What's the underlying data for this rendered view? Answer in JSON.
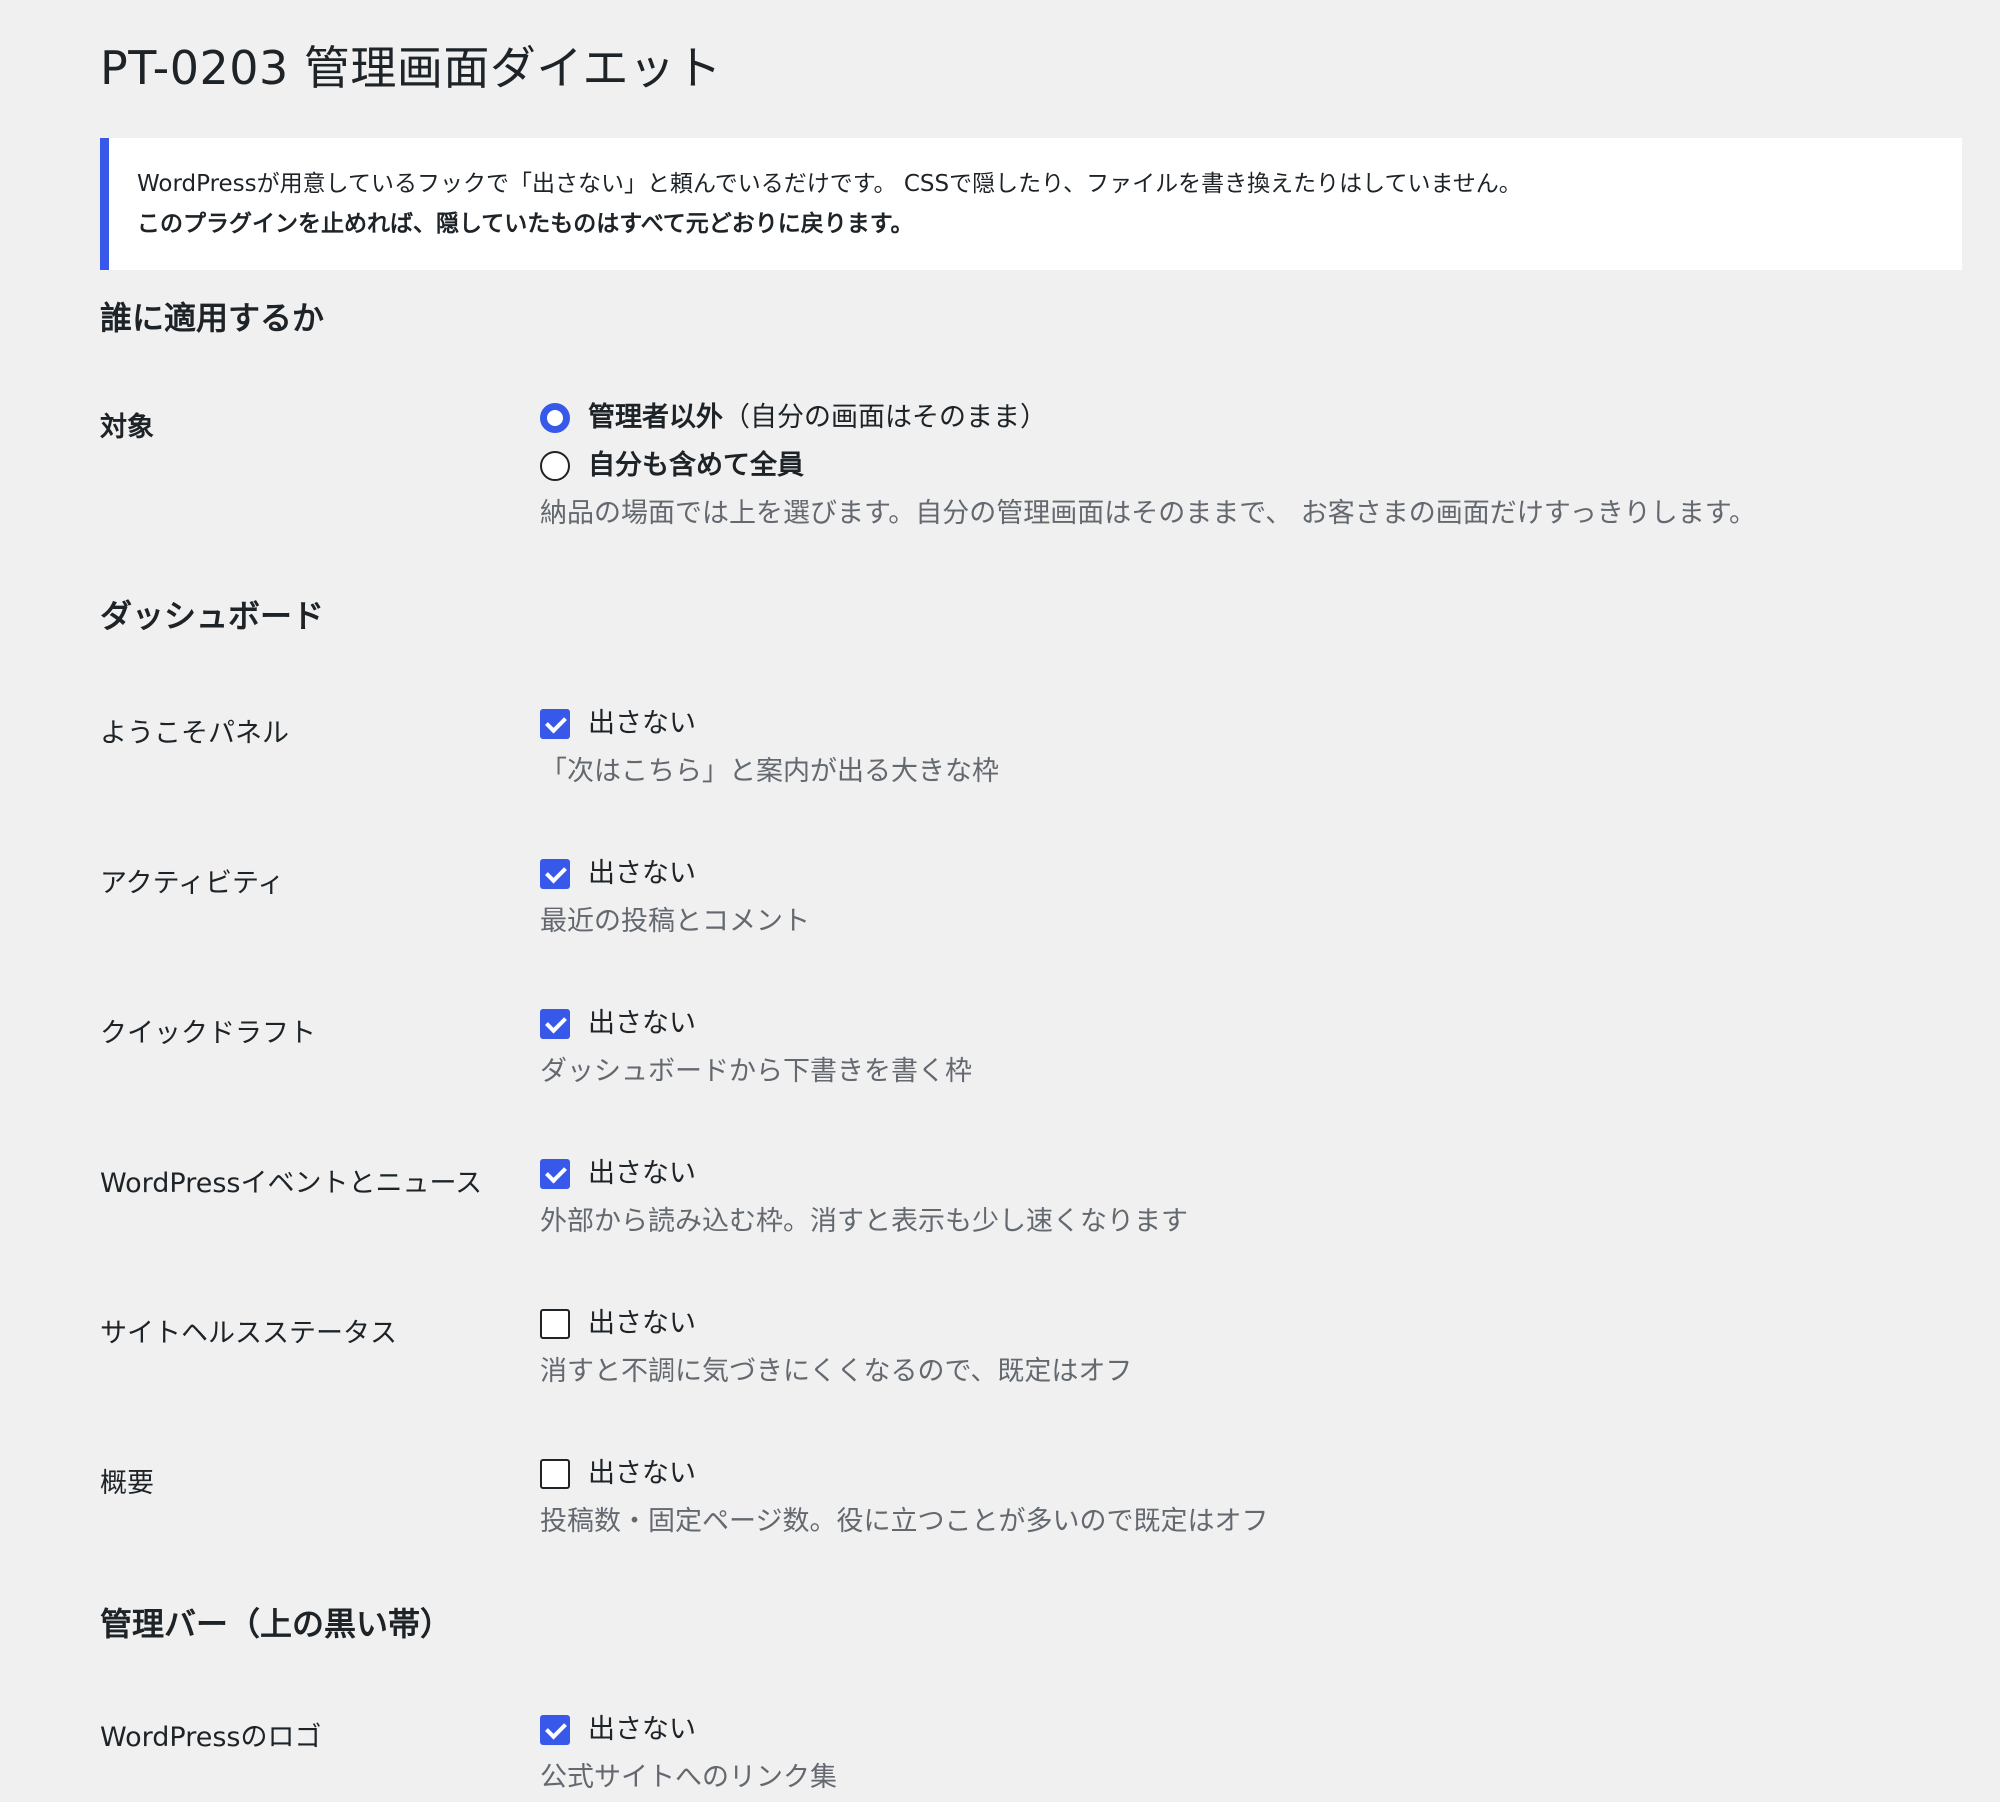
{
  "page": {
    "title": "PT-0203 管理画面ダイエット"
  },
  "notice": {
    "line1": "WordPressが用意しているフックで「出さない」と頼んでいるだけです。 CSSで隠したり、ファイルを書き換えたりはしていません。",
    "line2": "このプラグインを止めれば、隠していたものはすべて元どおりに戻ります。"
  },
  "sections": {
    "who": {
      "title": "誰に適用するか",
      "target": {
        "label": "対象",
        "options": [
          {
            "label": "管理者以外",
            "suffix": "（自分の画面はそのまま）",
            "checked": true
          },
          {
            "label": "自分も含めて全員",
            "suffix": "",
            "checked": false
          }
        ],
        "description": "納品の場面では上を選びます。自分の管理画面はそのままで、 お客さまの画面だけすっきりします。"
      }
    },
    "dashboard": {
      "title": "ダッシュボード",
      "rows": [
        {
          "label": "ようこそパネル",
          "option": "出さない",
          "checked": true,
          "description": "「次はこちら」と案内が出る大きな枠"
        },
        {
          "label": "アクティビティ",
          "option": "出さない",
          "checked": true,
          "description": "最近の投稿とコメント"
        },
        {
          "label": "クイックドラフト",
          "option": "出さない",
          "checked": true,
          "description": "ダッシュボードから下書きを書く枠"
        },
        {
          "label": "WordPressイベントとニュース",
          "option": "出さない",
          "checked": true,
          "description": "外部から読み込む枠。消すと表示も少し速くなります"
        },
        {
          "label": "サイトヘルスステータス",
          "option": "出さない",
          "checked": false,
          "description": "消すと不調に気づきにくくなるので、既定はオフ"
        },
        {
          "label": "概要",
          "option": "出さない",
          "checked": false,
          "description": "投稿数・固定ページ数。役に立つことが多いので既定はオフ"
        }
      ]
    },
    "adminbar": {
      "title": "管理バー（上の黒い帯）",
      "rows": [
        {
          "label": "WordPressのロゴ",
          "option": "出さない",
          "checked": true,
          "description": "公式サイトへのリンク集"
        }
      ]
    }
  },
  "colors": {
    "accent": "#3858e9",
    "background": "#f0f0f1",
    "text": "#1d2327",
    "description": "#646970"
  }
}
